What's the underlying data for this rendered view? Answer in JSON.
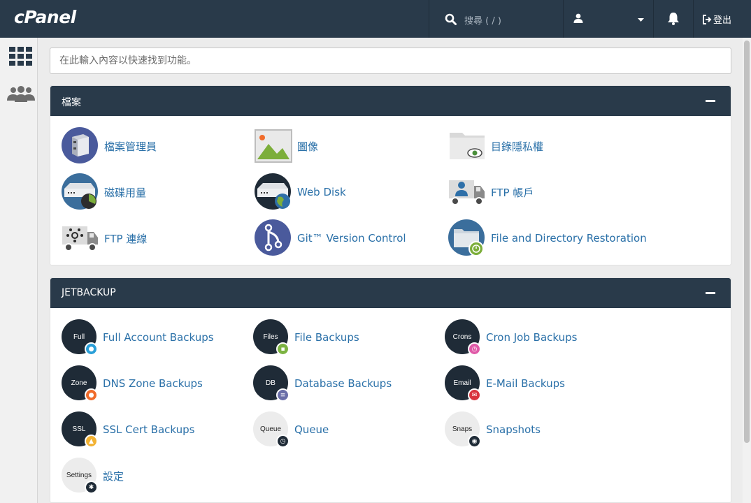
{
  "topbar": {
    "logo": "cPanel",
    "search_placeholder": "搜尋 ( / )",
    "logout_label": "登出"
  },
  "quick_search": {
    "placeholder": "在此輸入內容以快速找到功能。"
  },
  "files_panel": {
    "title": "檔案",
    "items": [
      {
        "label": "檔案管理員",
        "icon": "file-manager-icon"
      },
      {
        "label": "圖像",
        "icon": "images-icon"
      },
      {
        "label": "目錄隱私權",
        "icon": "directory-privacy-icon"
      },
      {
        "label": "磁碟用量",
        "icon": "disk-usage-icon"
      },
      {
        "label": "Web Disk",
        "icon": "web-disk-icon"
      },
      {
        "label": "FTP 帳戶",
        "icon": "ftp-accounts-icon"
      },
      {
        "label": "FTP 連線",
        "icon": "ftp-connections-icon"
      },
      {
        "label": "Git™ Version Control",
        "icon": "git-icon"
      },
      {
        "label": "File and Directory Restoration",
        "icon": "restoration-icon"
      }
    ]
  },
  "jetbackup_panel": {
    "title": "JETBACKUP",
    "items": [
      {
        "label": "Full Account Backups",
        "disc": "Full",
        "badge_color": "#2a9fd8"
      },
      {
        "label": "File Backups",
        "disc": "Files",
        "badge_color": "#7cb342"
      },
      {
        "label": "Cron Job Backups",
        "disc": "Crons",
        "badge_color": "#e05aa8"
      },
      {
        "label": "DNS Zone Backups",
        "disc": "Zone",
        "badge_color": "#f06b2a"
      },
      {
        "label": "Database Backups",
        "disc": "DB",
        "badge_color": "#6a6ea8"
      },
      {
        "label": "E-Mail Backups",
        "disc": "Email",
        "badge_color": "#d9343d"
      },
      {
        "label": "SSL Cert Backups",
        "disc": "SSL",
        "badge_color": "#f2b233"
      },
      {
        "label": "Queue",
        "disc": "Queue",
        "badge_color": "#1f2b37"
      },
      {
        "label": "Snapshots",
        "disc": "Snaps",
        "badge_color": "#1f2b37"
      },
      {
        "label": "設定",
        "disc": "Settings",
        "badge_color": "#1f2b37"
      }
    ]
  }
}
